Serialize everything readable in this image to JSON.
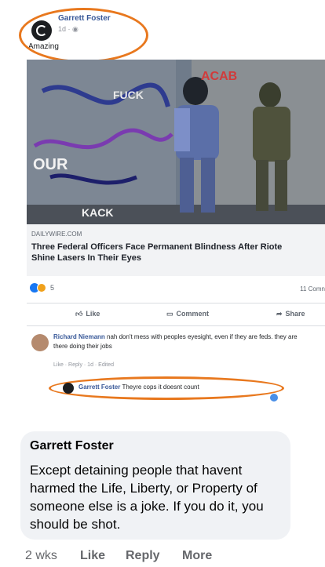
{
  "post": {
    "author": "Garrett Foster",
    "meta": "1d · ",
    "text": "Amazing",
    "link": {
      "domain": "DAILYWIRE.COM",
      "headline_line1": "Three Federal Officers Face Permanent Blindness After Riote",
      "headline_line2": "Shine Lasers In Their Eyes"
    },
    "reactions_count": "5",
    "comments_count": "11 Comn",
    "actions": [
      "Like",
      "Comment",
      "Share"
    ]
  },
  "comment": {
    "author": "Richard Niemann",
    "text": "nah don't mess with peoples eyesight, even if they are feds. they are there doing their jobs",
    "meta": "Like · Reply · 1d · Edited"
  },
  "reply": {
    "author": "Garrett Foster",
    "text": "Theyre cops it doesnt count"
  },
  "bubble": {
    "author": "Garrett Foster",
    "text": "Except detaining people that havent harmed the Life, Liberty, or Property of someone else is a joke. If you do it, you should be shot."
  },
  "footer": {
    "time": "2 wks",
    "like": "Like",
    "reply": "Reply",
    "more": "More"
  },
  "photo_graffiti": {
    "acab": "ACAB",
    "fuck": "FUCK",
    "text1": "OUR",
    "text2": "KACK"
  },
  "colors": {
    "accent_circle": "#e8781e",
    "link_blue": "#385898",
    "bubble_bg": "#f0f2f5"
  }
}
